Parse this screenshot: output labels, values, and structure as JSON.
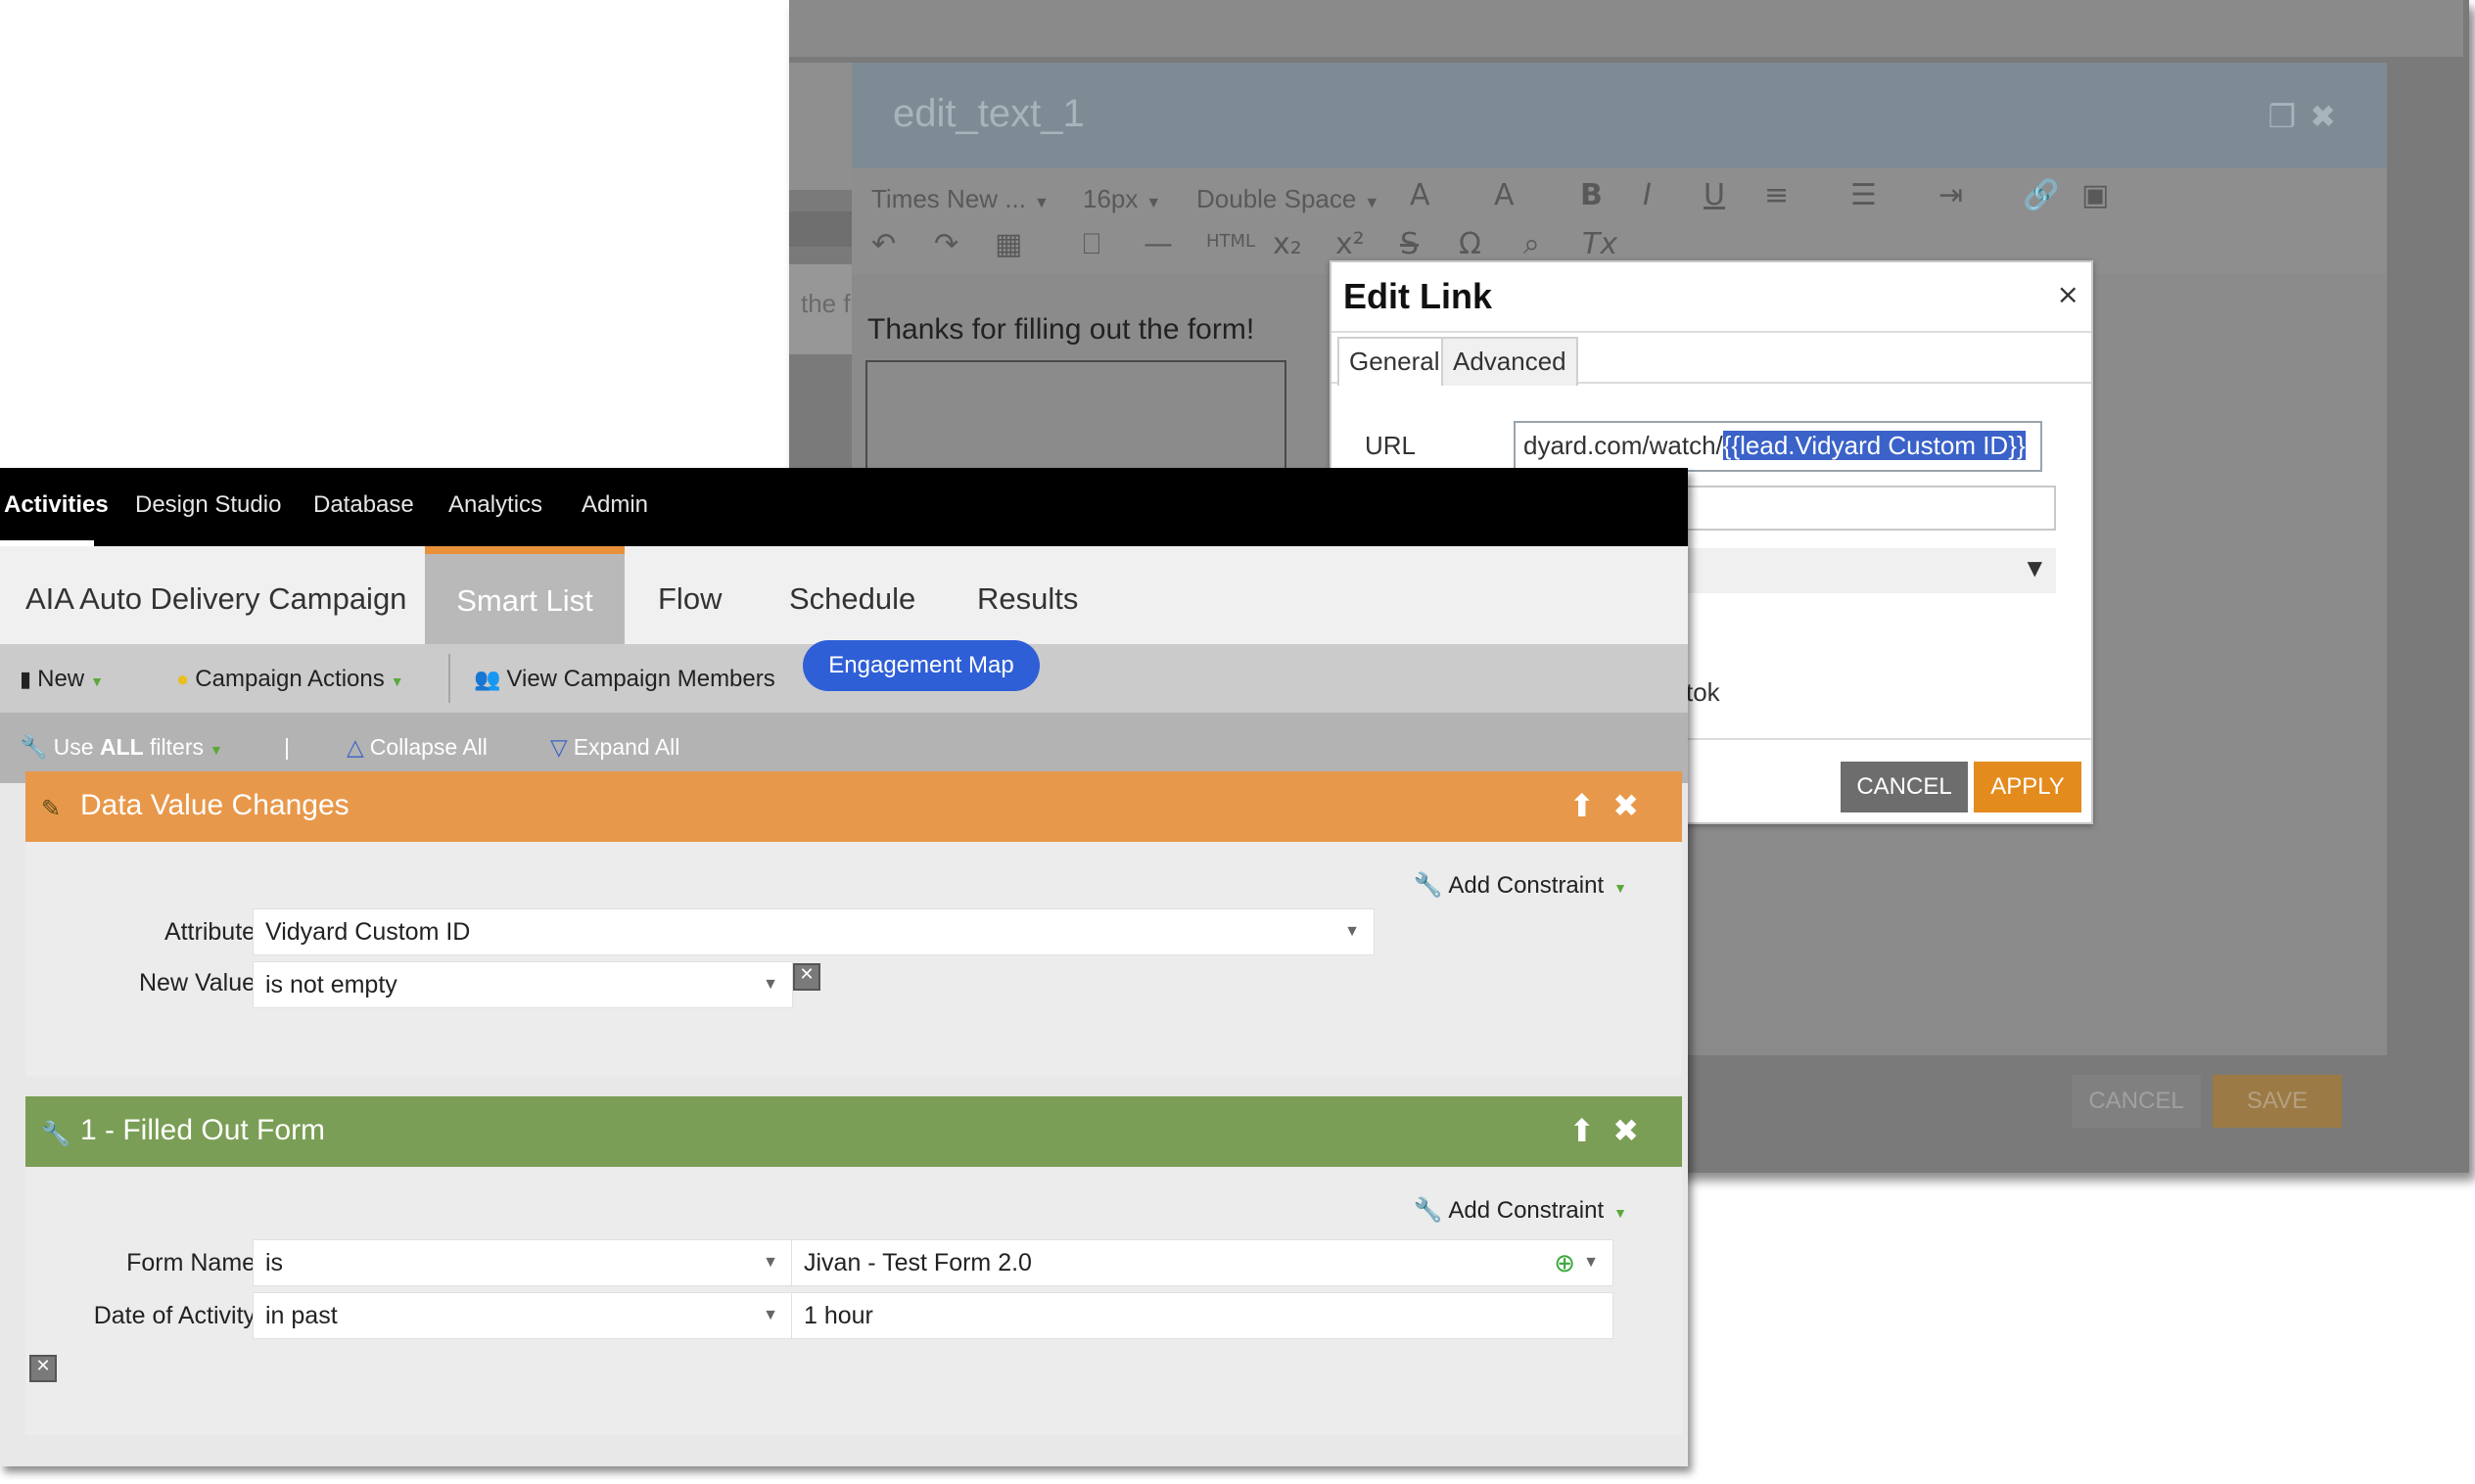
{
  "bg_editor": {
    "dialog_title": "edit_text_1",
    "toolbar": {
      "font": "Times New ...",
      "size": "16px",
      "spacing": "Double Space"
    },
    "content_text": "Thanks for filling out the form!",
    "fragment_text": "the f",
    "cancel_label": "CANCEL",
    "save_label": "SAVE"
  },
  "edit_link": {
    "title": "Edit Link",
    "close_label": "×",
    "tabs": [
      "General",
      "Advanced"
    ],
    "url_label": "URL",
    "url_prefix": "dyard.com/watch/",
    "url_selected": "{{lead.Vidyard Custom ID}}",
    "tok_text": "tok",
    "cancel_label": "CANCEL",
    "apply_label": "APPLY"
  },
  "topnav": {
    "items": [
      "Activities",
      "Design Studio",
      "Database",
      "Analytics",
      "Admin"
    ]
  },
  "campaign_tabs": [
    "AIA Auto Delivery Campaign",
    "Smart List",
    "Flow",
    "Schedule",
    "Results"
  ],
  "actionbar": {
    "new_label": "New",
    "campaign_actions_label": "Campaign Actions",
    "view_members_label": "View Campaign Members",
    "engagement_map_label": "Engagement Map"
  },
  "filterbar": {
    "use_prefix": "Use ",
    "use_bold": "ALL",
    "use_suffix": " filters",
    "separator": "|",
    "collapse_label": "Collapse All",
    "expand_label": "Expand All"
  },
  "filters": {
    "data_value_changes": {
      "title": "Data Value Changes",
      "add_constraint": "Add Constraint",
      "attribute_label": "Attribute:",
      "attribute_value": "Vidyard Custom ID",
      "new_value_label": "New Value:",
      "new_value_value": "is not empty"
    },
    "filled_out_form": {
      "title": "1 - Filled Out Form",
      "add_constraint": "Add Constraint",
      "form_name_label": "Form Name:",
      "form_name_operator": "is",
      "form_name_value": "Jivan - Test Form 2.0",
      "date_label": "Date of Activity:",
      "date_operator": "in past",
      "date_value": "1 hour"
    }
  },
  "colors": {
    "orange_header": "#e8984a",
    "green_header": "#7a9e55",
    "engagement_blue": "#2f5fd6",
    "apply_orange": "#e48b1e"
  }
}
